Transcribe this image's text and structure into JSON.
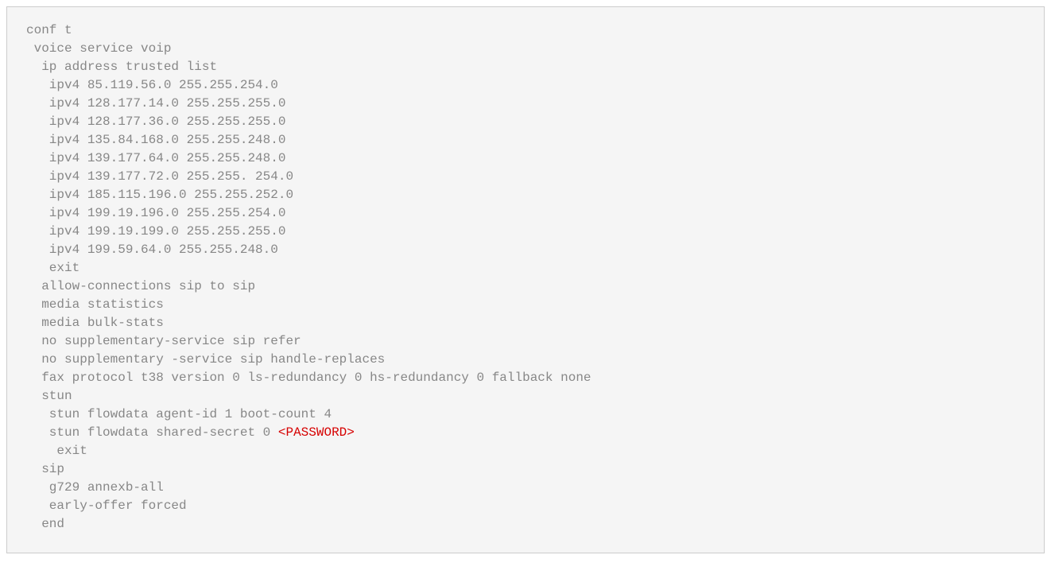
{
  "code": {
    "lines": [
      "conf t",
      " voice service voip",
      "  ip address trusted list",
      "   ipv4 85.119.56.0 255.255.254.0",
      "   ipv4 128.177.14.0 255.255.255.0",
      "   ipv4 128.177.36.0 255.255.255.0",
      "   ipv4 135.84.168.0 255.255.248.0",
      "   ipv4 139.177.64.0 255.255.248.0",
      "   ipv4 139.177.72.0 255.255. 254.0",
      "   ipv4 185.115.196.0 255.255.252.0",
      "   ipv4 199.19.196.0 255.255.254.0",
      "   ipv4 199.19.199.0 255.255.255.0",
      "   ipv4 199.59.64.0 255.255.248.0",
      "   exit",
      "  allow-connections sip to sip",
      "  media statistics",
      "  media bulk-stats",
      "  no supplementary-service sip refer",
      "  no supplementary -service sip handle-replaces",
      "  fax protocol t38 version 0 ls-redundancy 0 hs-redundancy 0 fallback none",
      "  stun",
      "   stun flowdata agent-id 1 boot-count 4"
    ],
    "secret_prefix": "   stun flowdata shared-secret 0 ",
    "secret_placeholder": "<PASSWORD>",
    "lines_after": [
      "    exit",
      "  sip",
      "   g729 annexb-all",
      "   early-offer forced",
      "  end"
    ]
  }
}
